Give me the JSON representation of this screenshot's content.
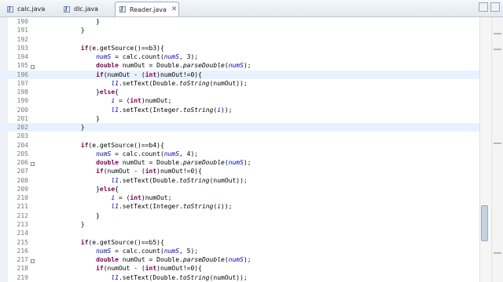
{
  "tabs": [
    {
      "label": "calc.java",
      "active": false
    },
    {
      "label": "dlc.java",
      "active": false
    },
    {
      "label": "Reader.java",
      "active": true
    }
  ],
  "tab_close_glyph": "✕",
  "java_icon_letter": "J",
  "colors": {
    "keyword": "#7f0055",
    "field": "#0000c0",
    "current_line": "#e8f2fe",
    "highlight": "#d4d4d4"
  },
  "lines": [
    {
      "n": "190",
      "c": "                }"
    },
    {
      "n": "191",
      "c": "            }"
    },
    {
      "n": "192",
      "c": ""
    },
    {
      "n": "193",
      "c": "            if(e.getSource()==b3){"
    },
    {
      "n": "194",
      "c": "                numS = calc.count(numS, 3);"
    },
    {
      "n": "195",
      "c": "                double numOut = Double.parseDouble(numS);"
    },
    {
      "n": "196",
      "c": "                if(numOut - (int)numOut!=0){"
    },
    {
      "n": "197",
      "c": "                    l1.setText(Double.toString(numOut));"
    },
    {
      "n": "198",
      "c": "                }else{"
    },
    {
      "n": "199",
      "c": "                    i = (int)numOut;"
    },
    {
      "n": "200",
      "c": "                    l1.setText(Integer.toString(i));"
    },
    {
      "n": "201",
      "c": "                }"
    },
    {
      "n": "202",
      "c": "            }"
    },
    {
      "n": "203",
      "c": ""
    },
    {
      "n": "204",
      "c": "            if(e.getSource()==b4){"
    },
    {
      "n": "205",
      "c": "                numS = calc.count(numS, 4);"
    },
    {
      "n": "206",
      "c": "                double numOut = Double.parseDouble(numS);"
    },
    {
      "n": "207",
      "c": "                if(numOut - (int)numOut!=0){"
    },
    {
      "n": "208",
      "c": "                    l1.setText(Double.toString(numOut));"
    },
    {
      "n": "209",
      "c": "                }else{"
    },
    {
      "n": "210",
      "c": "                    i = (int)numOut;"
    },
    {
      "n": "211",
      "c": "                    l1.setText(Integer.toString(i));"
    },
    {
      "n": "212",
      "c": "                }"
    },
    {
      "n": "213",
      "c": "            }"
    },
    {
      "n": "214",
      "c": ""
    },
    {
      "n": "215",
      "c": "            if(e.getSource()==b5){"
    },
    {
      "n": "216",
      "c": "                numS = calc.count(numS, 5);"
    },
    {
      "n": "217",
      "c": "                double numOut = Double.parseDouble(numS);"
    },
    {
      "n": "218",
      "c": "                if(numOut - (int)numOut!=0){"
    },
    {
      "n": "219",
      "c": "                    l1.setText(Double.toString(numOut));"
    }
  ]
}
